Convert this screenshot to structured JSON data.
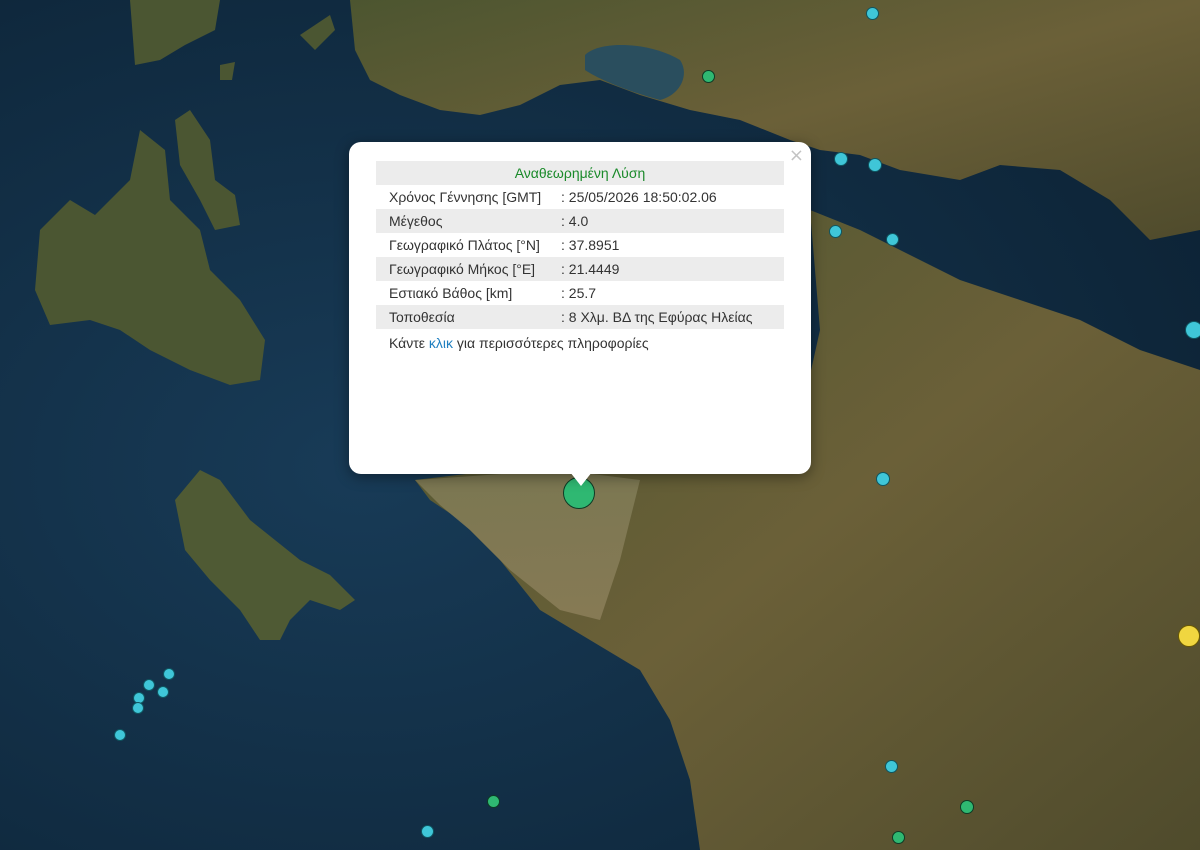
{
  "popup": {
    "title": "Αναθεωρημένη Λύση",
    "close_symbol": "×",
    "rows": [
      {
        "label": "Χρόνος Γέννησης [GMT]",
        "value": ": 25/05/2026 18:50:02.06"
      },
      {
        "label": "Μέγεθος",
        "value": ": 4.0"
      },
      {
        "label": "Γεωγραφικό Πλάτος [°N]",
        "value": ": 37.8951"
      },
      {
        "label": "Γεωγραφικό Μήκος [°E]",
        "value": ": 21.4449"
      },
      {
        "label": "Εστιακό Βάθος [km]",
        "value": ": 25.7"
      },
      {
        "label": "Τοποθεσία",
        "value": ": 8 Χλμ. ΒΔ της Εφύρας Ηλείας"
      }
    ],
    "footer_pre": "Κάντε ",
    "footer_link": "κλικ",
    "footer_post": " για περισσότερες πληροφορίες"
  },
  "marker_colors": {
    "cyan": "#3fc6d8",
    "green": "#2fb872",
    "yellow": "#f0d640"
  },
  "map_colors": {
    "sea": "#0f2a3f",
    "land": "#5a5a32"
  }
}
